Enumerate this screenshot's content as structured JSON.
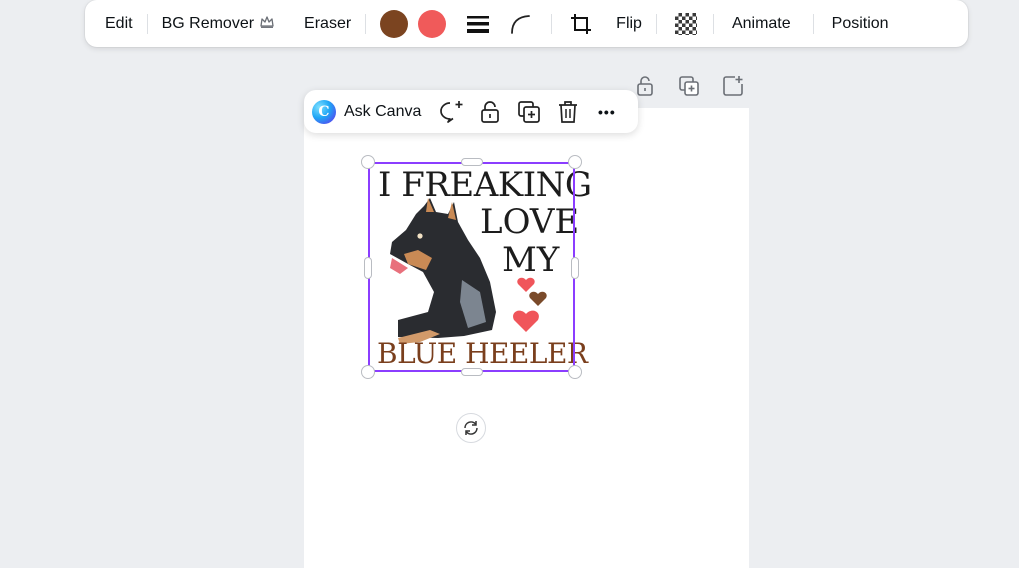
{
  "toolbar": {
    "edit": "Edit",
    "bg_remover": "BG Remover",
    "eraser": "Eraser",
    "swatch_colors": [
      "#7b4420",
      "#f05a5a"
    ],
    "flip": "Flip",
    "animate": "Animate",
    "position": "Position",
    "icons": [
      "crown-icon",
      "line-weight-icon",
      "corner-rounding-icon",
      "crop-icon",
      "transparency-icon"
    ]
  },
  "page_actions": {
    "icons": [
      "lock-icon",
      "duplicate-icon",
      "add-page-icon"
    ]
  },
  "context_menu": {
    "ask_label": "Ask Canva",
    "logo_letter": "C",
    "icons": [
      "comment-add-icon",
      "lock-icon",
      "duplicate-icon",
      "trash-icon",
      "more-icon"
    ],
    "more_glyph": "•••"
  },
  "artwork": {
    "line1": "I FREAKING",
    "line2": "LOVE",
    "line3": "MY",
    "line4": "BLUE HEELER",
    "colors": {
      "dark_text": "#1c1c1c",
      "brown_text": "#7a3f1d",
      "heart_red": "#f0555a",
      "heart_brown": "#7a4a2a",
      "accent": "#8b3dff"
    }
  }
}
